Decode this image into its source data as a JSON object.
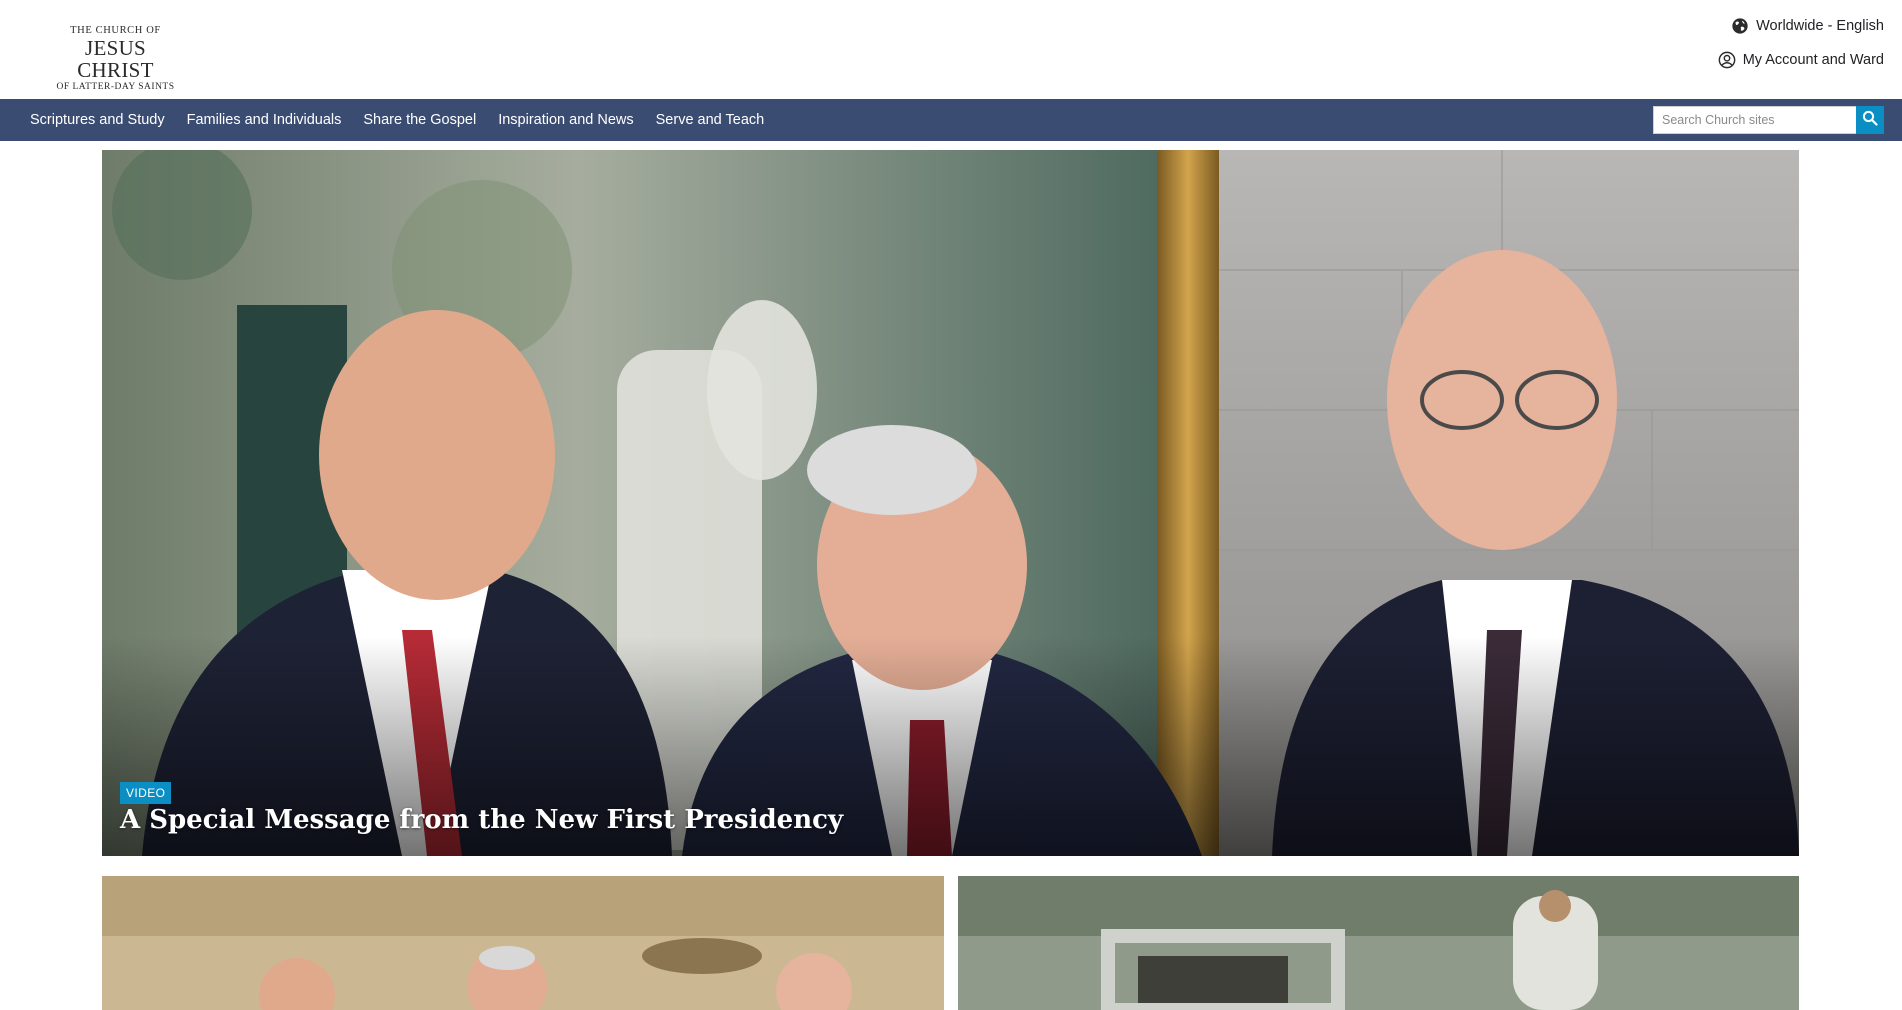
{
  "header": {
    "logo": {
      "line1": "THE CHURCH OF",
      "line2": "JESUS CHRIST",
      "line3": "OF LATTER-DAY SAINTS"
    },
    "language": {
      "label": "Worldwide - English",
      "icon": "globe-icon"
    },
    "account": {
      "label": "My Account and Ward",
      "icon": "user-circle-icon"
    }
  },
  "nav": {
    "items": [
      {
        "label": "Scriptures and Study"
      },
      {
        "label": "Families and Individuals"
      },
      {
        "label": "Share the Gospel"
      },
      {
        "label": "Inspiration and News"
      },
      {
        "label": "Serve and Teach"
      }
    ],
    "search": {
      "placeholder": "Search Church sites",
      "icon": "search-icon"
    }
  },
  "hero": {
    "badge": "VIDEO",
    "title": "A Special Message from the New First Presidency",
    "image": "three-men-in-suits-smiling-in-front-of-painting"
  },
  "cards": [
    {
      "image": "three-men-seated-in-front-of-painting"
    },
    {
      "image": "painting-of-christ-at-garden-tomb"
    }
  ],
  "colors": {
    "nav_bg": "#3a4c71",
    "accent": "#0b8ec4",
    "text": "#212225"
  }
}
